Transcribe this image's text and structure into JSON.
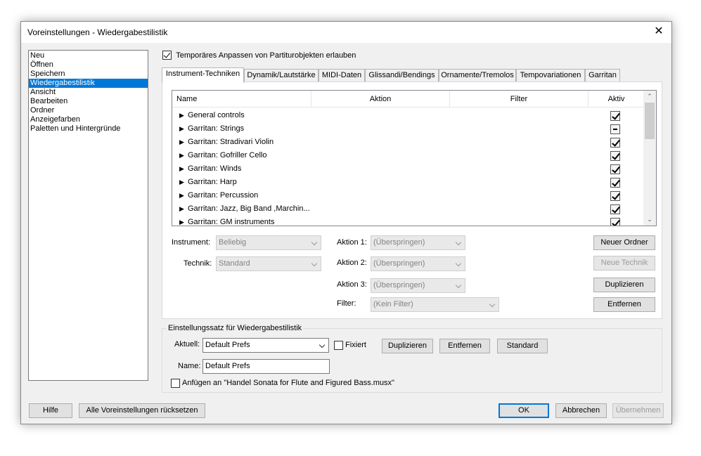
{
  "window": {
    "title": "Voreinstellungen - Wiedergabestilistik",
    "close_symbol": "✕"
  },
  "categories": [
    {
      "label": "Neu"
    },
    {
      "label": "Öffnen"
    },
    {
      "label": "Speichern"
    },
    {
      "label": "Wiedergabestilistik",
      "selected": true
    },
    {
      "label": "Ansicht"
    },
    {
      "label": "Bearbeiten"
    },
    {
      "label": "Ordner"
    },
    {
      "label": "Anzeigefarben"
    },
    {
      "label": "Paletten und Hintergründe"
    }
  ],
  "allow_temp": {
    "label": "Temporäres Anpassen von Partiturobjekten erlauben",
    "checked": true
  },
  "tabs": [
    {
      "label": "Instrument-Techniken",
      "active": true
    },
    {
      "label": "Dynamik/Lautstärke"
    },
    {
      "label": "MIDI-Daten"
    },
    {
      "label": "Glissandi/Bendings"
    },
    {
      "label": "Ornamente/Tremolos"
    },
    {
      "label": "Tempovariationen"
    },
    {
      "label": "Garritan"
    }
  ],
  "grid": {
    "columns": {
      "name": "Name",
      "action": "Aktion",
      "filter": "Filter",
      "active": "Aktiv"
    },
    "rows": [
      {
        "name": "General controls",
        "state": "checked"
      },
      {
        "name": "Garritan: Strings",
        "state": "mixed"
      },
      {
        "name": "Garritan: Stradivari Violin",
        "state": "checked"
      },
      {
        "name": "Garritan: Gofriller Cello",
        "state": "checked"
      },
      {
        "name": "Garritan: Winds",
        "state": "checked"
      },
      {
        "name": "Garritan: Harp",
        "state": "checked"
      },
      {
        "name": "Garritan: Percussion",
        "state": "checked"
      },
      {
        "name": "Garritan: Jazz, Big Band ,Marchin...",
        "state": "checked"
      },
      {
        "name": "Garritan: GM instruments",
        "state": "checked"
      }
    ],
    "expand_icon": "▶",
    "scroll_up": "⌃",
    "scroll_down": "⌄"
  },
  "form": {
    "instrument_label": "Instrument:",
    "instrument_value": "Beliebig",
    "technique_label": "Technik:",
    "technique_value": "Standard",
    "action1_label": "Aktion 1:",
    "action1_value": "(Überspringen)",
    "action2_label": "Aktion 2:",
    "action2_value": "(Überspringen)",
    "action3_label": "Aktion 3:",
    "action3_value": "(Überspringen)",
    "filter_label": "Filter:",
    "filter_value": "(Kein Filter)"
  },
  "side_buttons": {
    "new_folder": "Neuer Ordner",
    "new_technique": "Neue Technik",
    "duplicate": "Duplizieren",
    "remove": "Entfernen"
  },
  "settings_set": {
    "title": "Einstellungssatz für Wiedergabestilistik",
    "current_label": "Aktuell:",
    "current_value": "Default Prefs",
    "fixed_label": "Fixiert",
    "duplicate": "Duplizieren",
    "remove": "Entfernen",
    "default": "Standard",
    "name_label": "Name:",
    "name_value": "Default Prefs",
    "append_label": "Anfügen an \"Handel Sonata for Flute and Figured Bass.musx\""
  },
  "footer": {
    "help": "Hilfe",
    "reset_all": "Alle Voreinstellungen rücksetzen",
    "ok": "OK",
    "cancel": "Abbrechen",
    "apply": "Übernehmen"
  }
}
